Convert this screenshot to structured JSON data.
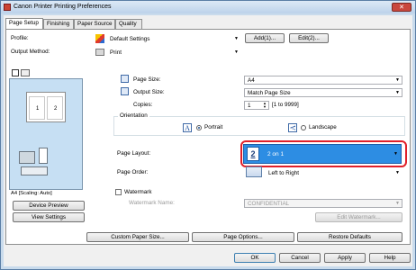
{
  "window": {
    "title": "Canon Printer Printing Preferences",
    "close_glyph": "✕"
  },
  "tabs": [
    {
      "label": "Page Setup"
    },
    {
      "label": "Finishing"
    },
    {
      "label": "Paper Source"
    },
    {
      "label": "Quality"
    }
  ],
  "profile": {
    "label": "Profile:",
    "value": "Default Settings",
    "add_label": "Add(1)...",
    "edit_label": "Edit(2)..."
  },
  "output_method": {
    "label": "Output Method:",
    "value": "Print"
  },
  "page_size": {
    "label": "Page Size:",
    "value": "A4"
  },
  "output_size": {
    "label": "Output Size:",
    "value": "Match Page Size"
  },
  "copies": {
    "label": "Copies:",
    "value": "1",
    "range": "[1 to 9999]"
  },
  "orientation": {
    "label": "Orientation",
    "portrait": "Portrait",
    "landscape": "Landscape",
    "selected": "Portrait"
  },
  "page_layout": {
    "label": "Page Layout:",
    "value": "2 on 1",
    "icon_text": "2"
  },
  "page_order": {
    "label": "Page Order:",
    "value": "Left to Right"
  },
  "watermark": {
    "label": "Watermark",
    "name_label": "Watermark Name:",
    "value": "CONFIDENTIAL",
    "edit_label": "Edit Watermark..."
  },
  "preview": {
    "caption": "A4 [Scaling: Auto]",
    "page_numbers": [
      "1",
      "2"
    ],
    "device_preview_label": "Device Preview",
    "view_settings_label": "View Settings"
  },
  "bottom_buttons": {
    "custom_paper_size": "Custom Paper Size...",
    "page_options": "Page Options...",
    "restore_defaults": "Restore Defaults"
  },
  "dialog_buttons": {
    "ok": "OK",
    "cancel": "Cancel",
    "apply": "Apply",
    "help": "Help"
  },
  "colors": {
    "highlight_border": "#e0202a",
    "selected_row": "#2d8de3",
    "titlebar": "#c9dbec"
  }
}
